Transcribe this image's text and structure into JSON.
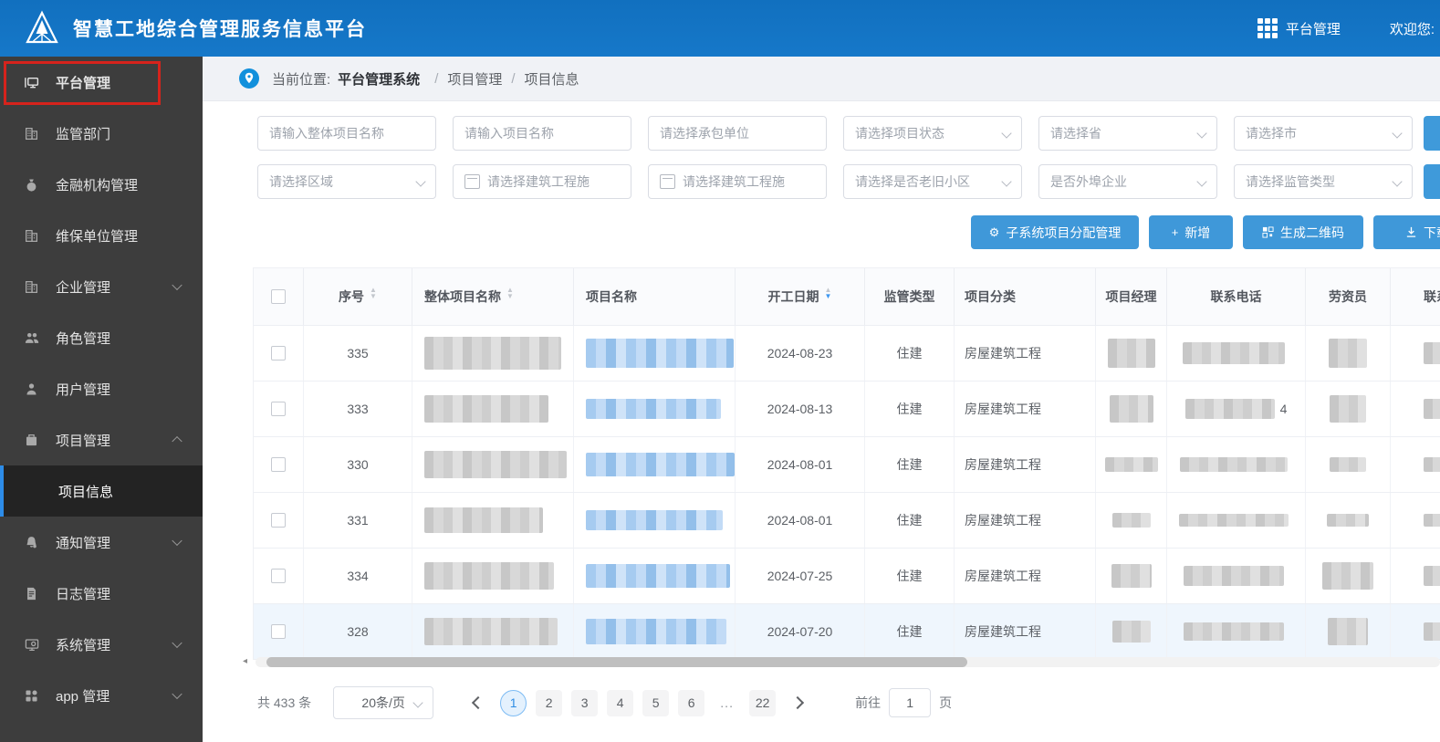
{
  "header": {
    "title": "智慧工地综合管理服务信息平台",
    "platform": "平台管理",
    "welcome": "欢迎您:"
  },
  "sidebar": {
    "items": [
      {
        "label": "平台管理"
      },
      {
        "label": "监管部门"
      },
      {
        "label": "金融机构管理"
      },
      {
        "label": "维保单位管理"
      },
      {
        "label": "企业管理"
      },
      {
        "label": "角色管理"
      },
      {
        "label": "用户管理"
      },
      {
        "label": "项目管理"
      },
      {
        "label": "通知管理"
      },
      {
        "label": "日志管理"
      },
      {
        "label": "系统管理"
      },
      {
        "label": "app 管理"
      }
    ],
    "sub_item": {
      "label": "项目信息"
    }
  },
  "breadcrumb": {
    "prefix": "当前位置:",
    "root": "平台管理系统",
    "sep1": "/",
    "level1": "项目管理",
    "sep2": "/",
    "level2": "项目信息"
  },
  "filters": {
    "f1": "请输入整体项目名称",
    "f2": "请输入项目名称",
    "f3": "请选择承包单位",
    "f4": "请选择项目状态",
    "f5": "请选择省",
    "f6": "请选择市",
    "f7": "请选择区域",
    "f8": "请选择建筑工程施",
    "f9": "请选择建筑工程施",
    "f10": "请选择是否老旧小区",
    "f11": "是否外埠企业",
    "f12": "请选择监管类型"
  },
  "toolbar": {
    "assign": "子系统项目分配管理",
    "add": "新增",
    "qr": "生成二维码",
    "download": "下载",
    "gear_icon": "⚙",
    "plus_icon": "+"
  },
  "table": {
    "columns": [
      "序号",
      "整体项目名称",
      "项目名称",
      "开工日期",
      "监管类型",
      "项目分类",
      "项目经理",
      "联系电话",
      "劳资员",
      "联系电话"
    ],
    "rows": [
      {
        "seq": "335",
        "date": "2024-08-23",
        "sup": "住建",
        "cat": "房屋建筑工程",
        "phone": ""
      },
      {
        "seq": "333",
        "date": "2024-08-13",
        "sup": "住建",
        "cat": "房屋建筑工程",
        "phone": "4"
      },
      {
        "seq": "330",
        "date": "2024-08-01",
        "sup": "住建",
        "cat": "房屋建筑工程",
        "phone": ""
      },
      {
        "seq": "331",
        "date": "2024-08-01",
        "sup": "住建",
        "cat": "房屋建筑工程",
        "phone": ""
      },
      {
        "seq": "334",
        "date": "2024-07-25",
        "sup": "住建",
        "cat": "房屋建筑工程",
        "phone": ""
      },
      {
        "seq": "328",
        "date": "2024-07-20",
        "sup": "住建",
        "cat": "房屋建筑工程",
        "phone": ""
      }
    ]
  },
  "pagination": {
    "total": "共 433 条",
    "page_size": "20条/页",
    "pages": [
      "1",
      "2",
      "3",
      "4",
      "5",
      "6",
      "...",
      "22"
    ],
    "active_page": "1",
    "goto_label": "前往",
    "goto_value": "1",
    "goto_unit": "页"
  }
}
